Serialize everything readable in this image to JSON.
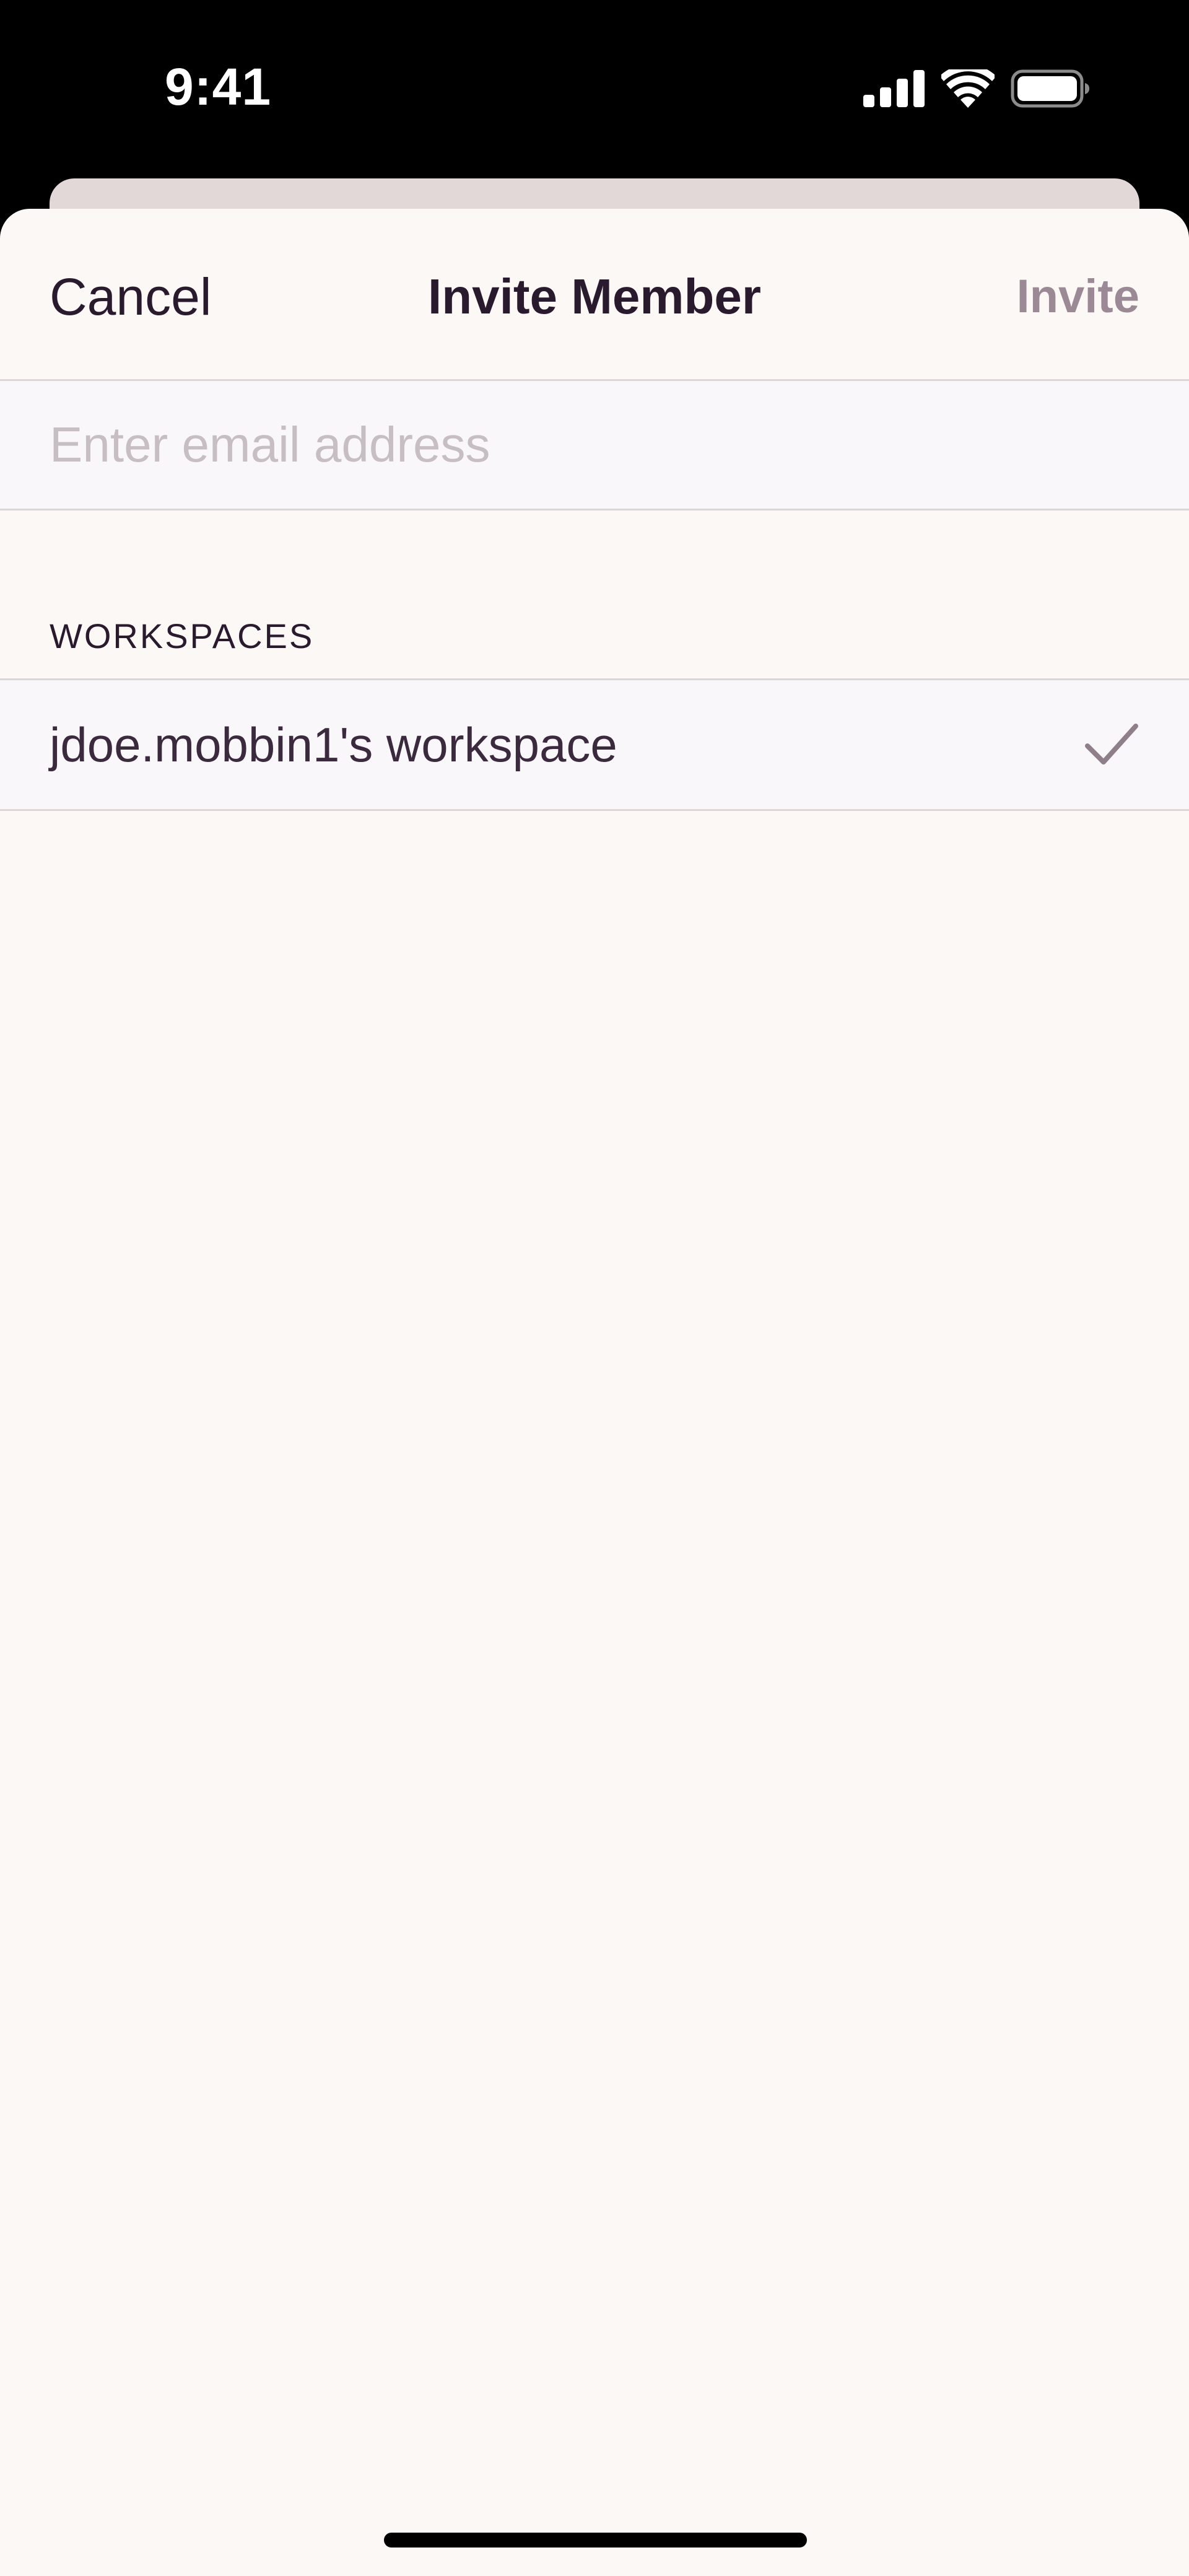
{
  "status_bar": {
    "time": "9:41",
    "icons": [
      "signal-icon",
      "wifi-icon",
      "battery-icon"
    ]
  },
  "nav": {
    "cancel_label": "Cancel",
    "title": "Invite Member",
    "invite_label": "Invite"
  },
  "email": {
    "value": "",
    "placeholder": "Enter email address"
  },
  "workspaces": {
    "header": "WORKSPACES",
    "items": [
      {
        "label": "jdoe.mobbin1's workspace",
        "selected": true,
        "icon": "checkmark-icon"
      }
    ]
  },
  "colors": {
    "background": "#fcf8f6",
    "text": "#2a1a2e",
    "accent_muted": "#9b8a96",
    "placeholder": "#c6bec2",
    "back_card": "#e3d8d8"
  }
}
